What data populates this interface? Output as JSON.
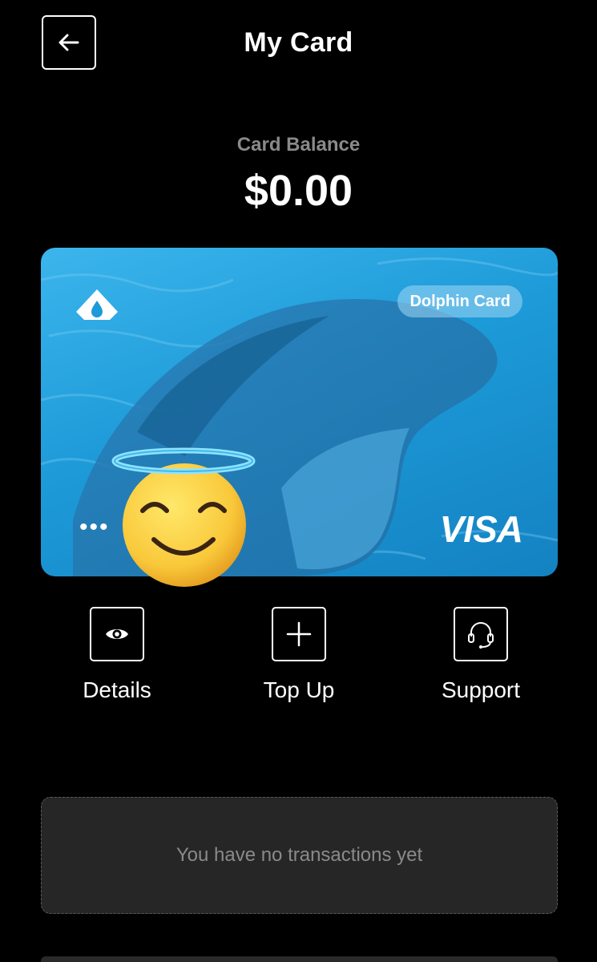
{
  "header": {
    "title": "My Card",
    "back_icon": "arrow-left-icon"
  },
  "balance": {
    "label": "Card Balance",
    "value": "$0.00"
  },
  "card": {
    "name": "Dolphin Card",
    "masked_number": "•••",
    "network": "VISA",
    "brand_icon": "drop-logo-icon",
    "overlay_icon": "smiling-face-with-halo-emoji",
    "accent_color": "#1d9ad8"
  },
  "actions": [
    {
      "label": "Details",
      "icon": "eye-icon"
    },
    {
      "label": "Top Up",
      "icon": "plus-icon"
    },
    {
      "label": "Support",
      "icon": "headset-icon"
    }
  ],
  "transactions": {
    "empty_text": "You have no transactions yet"
  }
}
